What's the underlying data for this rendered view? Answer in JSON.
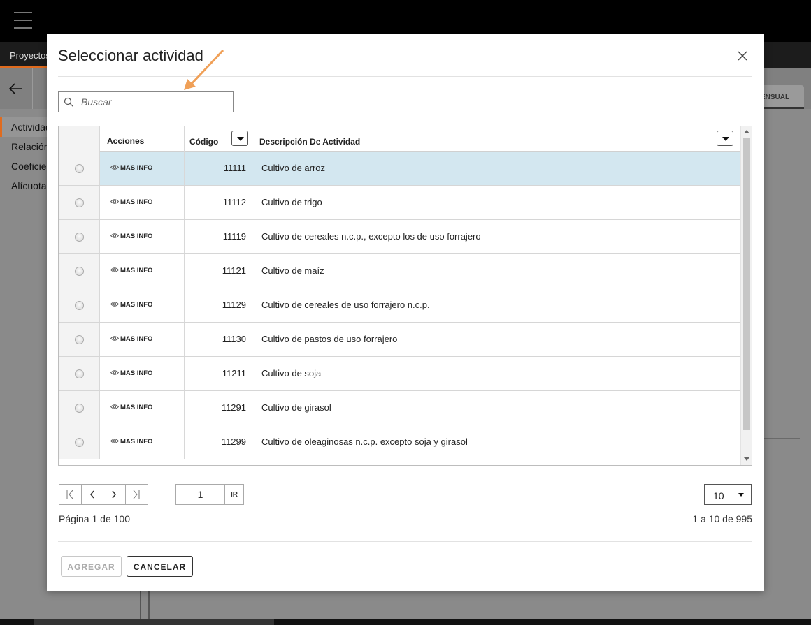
{
  "app": {
    "tab_active": "Proyectos",
    "right_tab": "ENSUAL",
    "nav": [
      {
        "label": "Actividades"
      },
      {
        "label": "Relación"
      },
      {
        "label": "Coeficientes"
      },
      {
        "label": "Alícuotas"
      }
    ]
  },
  "modal": {
    "title": "Seleccionar actividad",
    "search": {
      "placeholder": "Buscar",
      "value": ""
    },
    "columns": {
      "actions": "Acciones",
      "code": "Código",
      "description": "Descripción De Actividad"
    },
    "action_label": "MAS INFO",
    "rows": [
      {
        "code": "11111",
        "description": "Cultivo de arroz",
        "selected": true
      },
      {
        "code": "11112",
        "description": "Cultivo de trigo"
      },
      {
        "code": "11119",
        "description": "Cultivo de cereales n.c.p., excepto los de uso forrajero"
      },
      {
        "code": "11121",
        "description": "Cultivo de maíz"
      },
      {
        "code": "11129",
        "description": "Cultivo de cereales de uso forrajero n.c.p."
      },
      {
        "code": "11130",
        "description": "Cultivo de pastos de uso forrajero"
      },
      {
        "code": "11211",
        "description": "Cultivo de soja"
      },
      {
        "code": "11291",
        "description": "Cultivo de girasol"
      },
      {
        "code": "11299",
        "description": "Cultivo de oleaginosas n.c.p. excepto soja y girasol"
      }
    ],
    "pagination": {
      "page_value": "1",
      "go_label": "IR",
      "page_info": "Página 1 de 100",
      "page_size": "10",
      "range_info": "1 a 10 de 995"
    },
    "buttons": {
      "add": "AGREGAR",
      "cancel": "CANCELAR"
    },
    "colors": {
      "accent": "#e06b1e",
      "selected_row": "#d3e7f0",
      "annotation_arrow": "#f0a057"
    }
  }
}
